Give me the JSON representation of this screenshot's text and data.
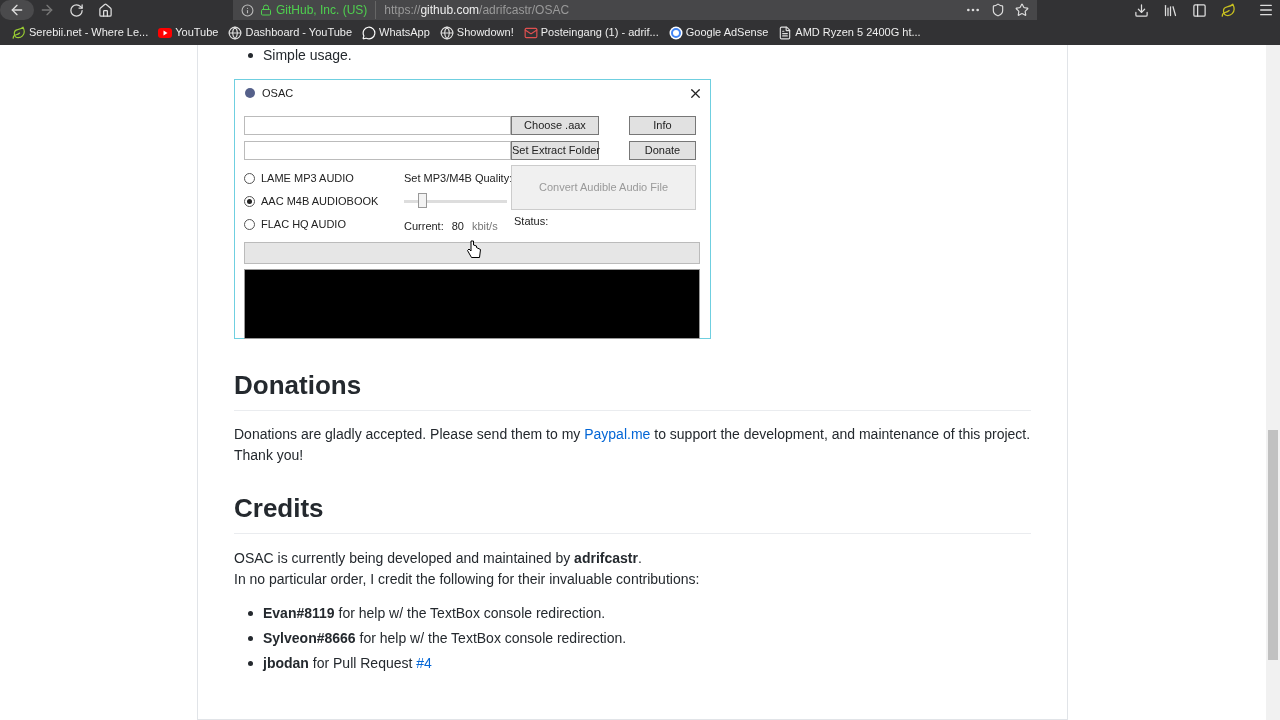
{
  "browser": {
    "identity": "GitHub, Inc. (US)",
    "url_scheme": "https://",
    "url_host": "github.com",
    "url_path": "/adrifcastr/OSAC"
  },
  "bookmarks": [
    {
      "label": "Serebii.net - Where Le...",
      "kind": "leaf"
    },
    {
      "label": "YouTube",
      "kind": "youtube"
    },
    {
      "label": "Dashboard - YouTube",
      "kind": "globe"
    },
    {
      "label": "WhatsApp",
      "kind": "whatsapp"
    },
    {
      "label": "Showdown!",
      "kind": "globe"
    },
    {
      "label": "Posteingang (1) - adrif...",
      "kind": "mail"
    },
    {
      "label": "Google AdSense",
      "kind": "google"
    },
    {
      "label": "AMD Ryzen 5 2400G ht...",
      "kind": "page"
    }
  ],
  "readme": {
    "top_bullet": "Simple usage.",
    "app": {
      "title": "OSAC",
      "buttons": [
        "Choose .aax",
        "Set Extract Folder"
      ],
      "side_buttons": [
        "Info",
        "Donate"
      ],
      "formats": [
        {
          "label": "LAME MP3 AUDIO",
          "selected": false
        },
        {
          "label": "AAC M4B AUDIOBOOK",
          "selected": true
        },
        {
          "label": "FLAC HQ AUDIO",
          "selected": false
        }
      ],
      "quality_label": "Set MP3/M4B Quality:",
      "quality": {
        "level": 0.17
      },
      "current_label": "Current:",
      "current_value": "80",
      "unit": "kbit/s",
      "convert_button": {
        "label": "Convert Audible Audio File",
        "disabled": true
      },
      "status_label": "Status:",
      "progress": {
        "level": 0
      }
    },
    "donations": {
      "heading": "Donations",
      "before": "Donations are gladly accepted. Please send them to my ",
      "link": "Paypal.me",
      "after": " to support the development, and maintenance of this project. Thank you!"
    },
    "credits": {
      "heading": "Credits",
      "line1": "OSAC is currently being developed and maintained by **adrifcastr**.",
      "line2": "In no particular order, I credit the following for their invaluable contributions:",
      "items": [
        {
          "text": "**Evan#8119** for help w/ the TextBox console redirection."
        },
        {
          "text": "**Sylveon#8666** for help w/ the TextBox console redirection."
        },
        {
          "text": "**jbodan** for Pull Request ",
          "link": "#4"
        }
      ]
    }
  }
}
